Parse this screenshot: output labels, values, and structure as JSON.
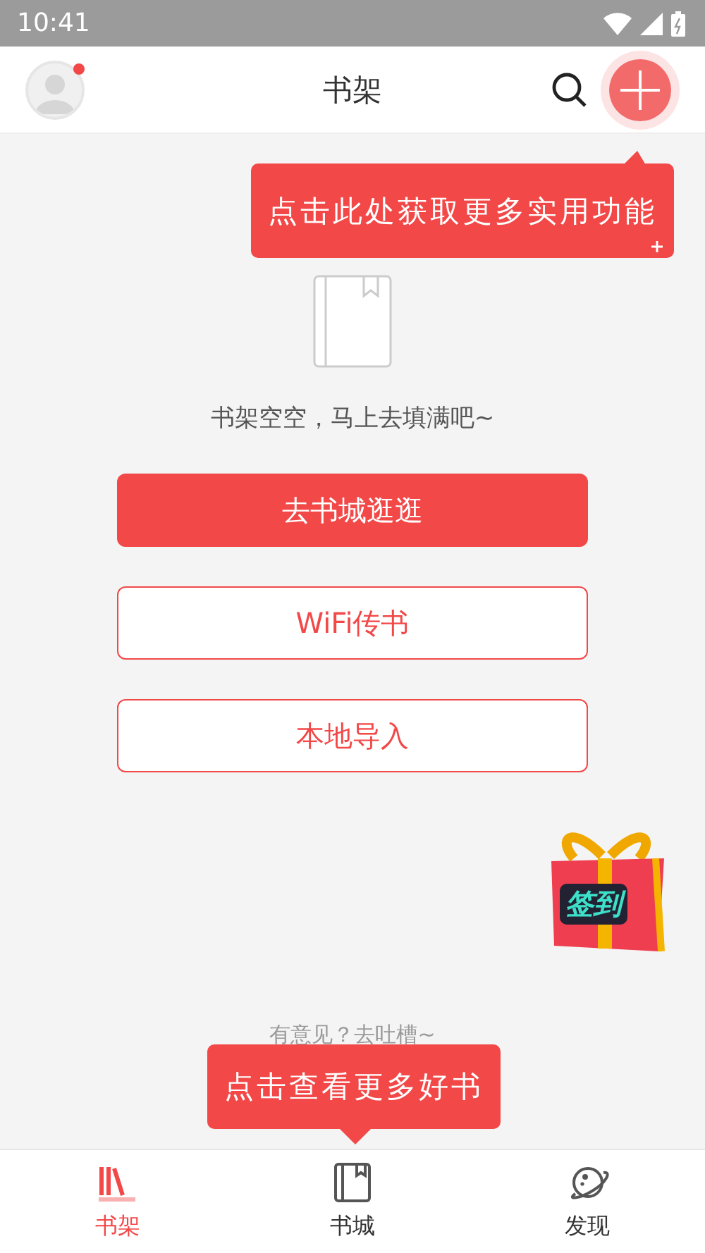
{
  "status_bar": {
    "time": "10:41"
  },
  "header": {
    "title": "书架",
    "has_notification": true
  },
  "tip_top": "点击此处获取更多实用功能",
  "empty": {
    "message": "书架空空，马上去填满吧~"
  },
  "buttons": [
    {
      "label": "去书城逛逛",
      "kind": "primary"
    },
    {
      "label": "WiFi传书",
      "kind": "outline"
    },
    {
      "label": "本地导入",
      "kind": "outline"
    }
  ],
  "gift": {
    "label": "签到"
  },
  "feedback": "有意见？去吐槽~",
  "tip_bottom": "点击查看更多好书",
  "tabs": [
    {
      "label": "书架",
      "kind": "shelf",
      "selected": true
    },
    {
      "label": "书城",
      "kind": "store",
      "selected": false
    },
    {
      "label": "发现",
      "kind": "discover",
      "selected": false
    }
  ]
}
